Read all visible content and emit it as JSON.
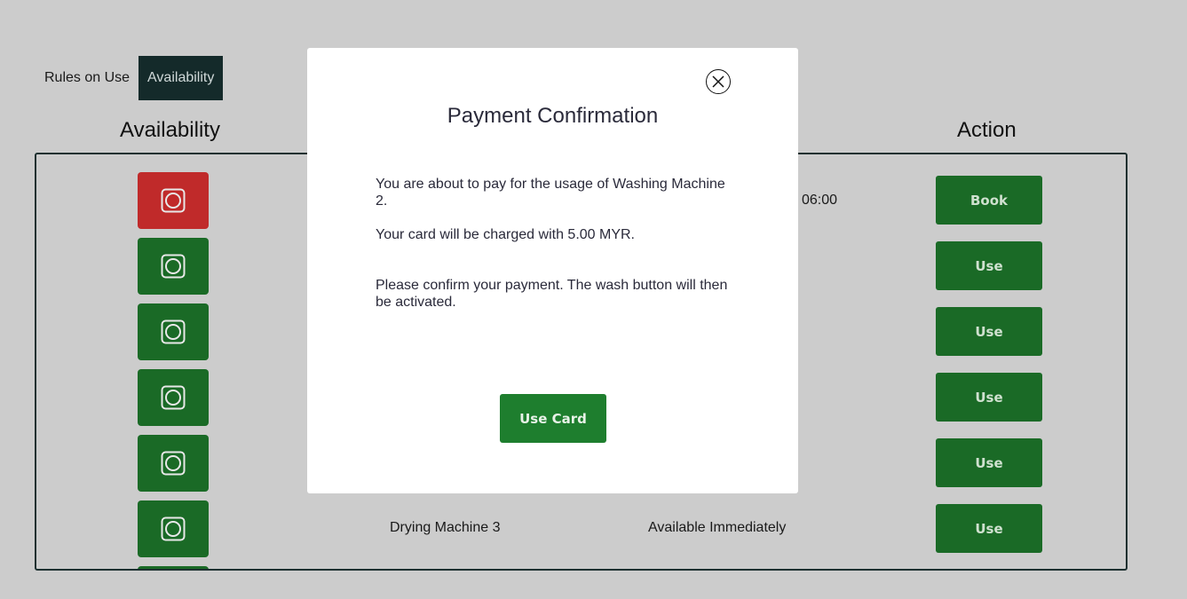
{
  "tabs": {
    "rules": "Rules on Use",
    "availability": "Availability"
  },
  "table": {
    "headers": {
      "availability": "Availability",
      "action": "Action"
    },
    "rows": [
      {
        "status": "occupied",
        "machine": "",
        "availability": "",
        "action": "Book"
      },
      {
        "status": "free",
        "machine": "",
        "availability": "",
        "action": "Use"
      },
      {
        "status": "free",
        "machine": "",
        "availability": "",
        "action": "Use"
      },
      {
        "status": "free",
        "machine": "",
        "availability": "",
        "action": "Use"
      },
      {
        "status": "free",
        "machine": "",
        "availability": "",
        "action": "Use"
      },
      {
        "status": "free",
        "machine": "Drying Machine 3",
        "availability": "Available Immediately",
        "action": "Use"
      }
    ],
    "partial_timeslot": "06:00"
  },
  "modal": {
    "title": "Payment Confirmation",
    "paragraph1": "You are about to pay for the usage of Washing Machine 2.",
    "paragraph2": "Your card will be charged with 5.00 MYR.",
    "paragraph3": "Please confirm your payment. The wash button will then be activated.",
    "confirm_button": "Use Card",
    "close_icon": "close-icon"
  },
  "colors": {
    "background": "#cccccc",
    "active_tab": "#142a2a",
    "status_free": "#1a6a26",
    "status_occupied": "#c02a2a",
    "button_green": "#1a6a26",
    "modal_button": "#1e7e2e"
  },
  "icons": {
    "machine": "washing-machine-icon"
  }
}
